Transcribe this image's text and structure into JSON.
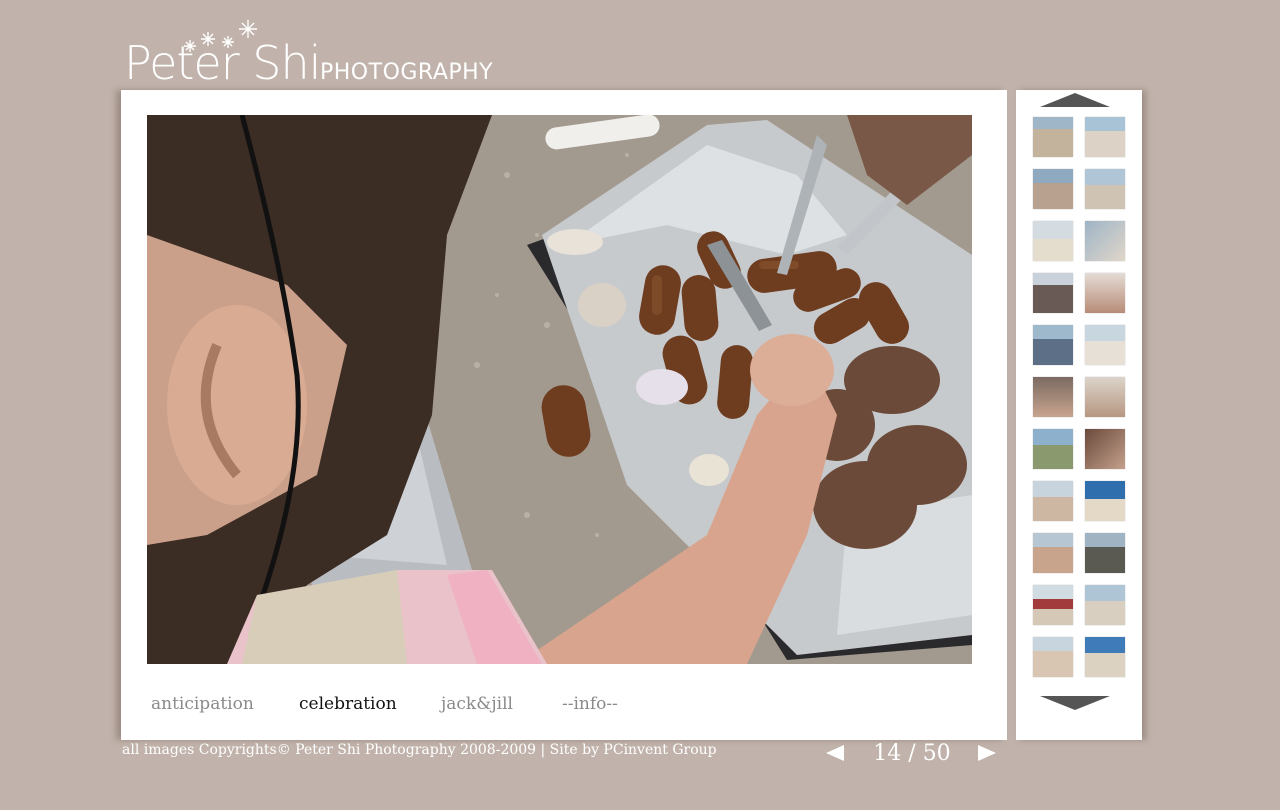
{
  "logo": {
    "name": "Peter Shi",
    "subtitle": "PHOTOGRAPHY"
  },
  "nav": {
    "items": [
      {
        "label": "anticipation",
        "active": false
      },
      {
        "label": "celebration",
        "active": true
      },
      {
        "label": "jack&jill",
        "active": false
      },
      {
        "label": "--info--",
        "active": false
      }
    ]
  },
  "footer": {
    "copyright": "all images Copyrights© Peter Shi Photography 2008-2009 | Site by PCinvent Group"
  },
  "gallery": {
    "current": "14",
    "separator": "/",
    "total": "50",
    "counter_text": "14 / 50",
    "icons": {
      "prev": "triangle-left-icon",
      "next": "triangle-right-icon",
      "scroll_up": "triangle-up-icon",
      "scroll_down": "triangle-down-icon"
    }
  },
  "colors": {
    "background": "#c1b3ab",
    "panel": "#ffffff",
    "nav_active": "#111111",
    "nav_inactive": "#8a8a8a",
    "arrow": "#555555"
  }
}
